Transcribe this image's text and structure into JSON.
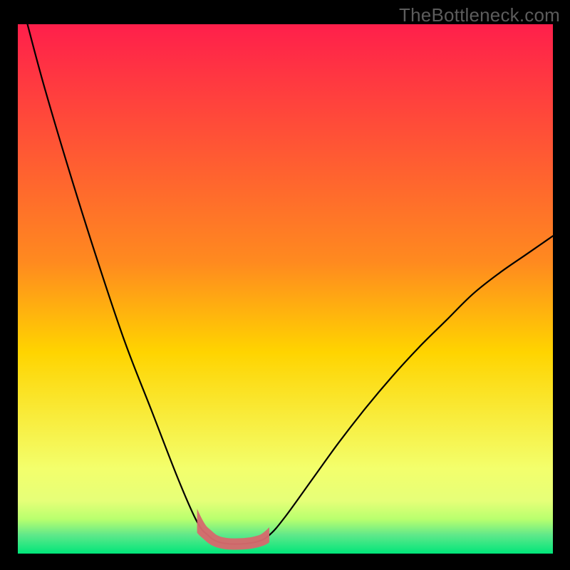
{
  "watermark": "TheBottleneck.com",
  "colors": {
    "frame": "#000000",
    "curve": "#000000",
    "highlight": "#d56a6d",
    "gradient_top": "#ff1f4b",
    "gradient_mid": "#ffd400",
    "gradient_low": "#f3ff6c",
    "gradient_band": "#b8ff6e",
    "gradient_bottom": "#00e67a"
  },
  "chart_data": {
    "type": "line",
    "title": "",
    "xlabel": "",
    "ylabel": "",
    "xlim": [
      0,
      1
    ],
    "ylim": [
      0,
      1
    ],
    "series": [
      {
        "name": "curve",
        "x": [
          0.018,
          0.05,
          0.1,
          0.15,
          0.2,
          0.25,
          0.3,
          0.335,
          0.355,
          0.375,
          0.405,
          0.445,
          0.47,
          0.5,
          0.55,
          0.6,
          0.65,
          0.7,
          0.75,
          0.8,
          0.85,
          0.9,
          0.95,
          1.0
        ],
        "y": [
          1.0,
          0.88,
          0.71,
          0.55,
          0.4,
          0.27,
          0.14,
          0.06,
          0.035,
          0.022,
          0.018,
          0.022,
          0.035,
          0.07,
          0.14,
          0.21,
          0.275,
          0.335,
          0.39,
          0.44,
          0.49,
          0.53,
          0.565,
          0.6
        ]
      }
    ],
    "highlight_range_x": [
      0.335,
      0.47
    ],
    "trough_x": 0.41,
    "trough_y": 0.018
  }
}
